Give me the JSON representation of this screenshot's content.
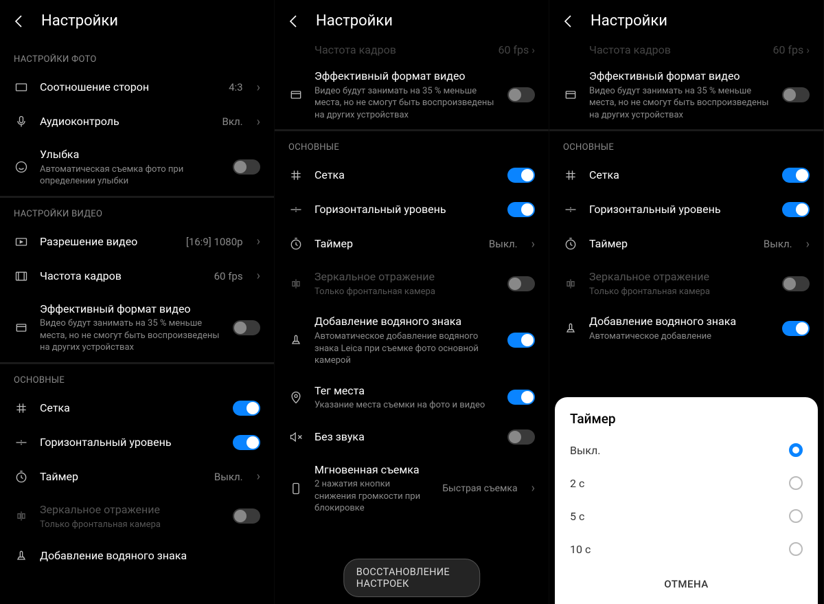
{
  "header": {
    "title": "Настройки"
  },
  "sections": {
    "photo": "НАСТРОЙКИ ФОТО",
    "video": "НАСТРОЙКИ ВИДЕО",
    "main": "ОСНОВНЫЕ"
  },
  "s1": {
    "aspect": {
      "label": "Соотношение сторон",
      "value": "4:3"
    },
    "audio": {
      "label": "Аудиоконтроль",
      "value": "Вкл."
    },
    "smile": {
      "label": "Улыбка",
      "sub": "Автоматическая съемка фото при определении улыбки"
    },
    "resolution": {
      "label": "Разрешение видео",
      "value": "[16:9] 1080p"
    },
    "fps": {
      "label": "Частота кадров",
      "value": "60 fps"
    },
    "efficient": {
      "label": "Эффективный формат видео",
      "sub": "Видео будут занимать на 35 % меньше места, но не смогут быть воспроизведены на других устройствах"
    },
    "grid": {
      "label": "Сетка"
    },
    "level": {
      "label": "Горизонтальный уровень"
    },
    "timer": {
      "label": "Таймер",
      "value": "Выкл."
    },
    "mirror": {
      "label": "Зеркальное отражение",
      "sub": "Только фронтальная камера"
    },
    "watermark": {
      "label": "Добавление водяного знака"
    }
  },
  "s2": {
    "fps_clip": {
      "label": "Частота кадров",
      "value": "60 fps"
    },
    "efficient": {
      "label": "Эффективный формат видео",
      "sub": "Видео будут занимать на 35 % меньше места, но не смогут быть воспроизведены на других устройствах"
    },
    "grid": {
      "label": "Сетка"
    },
    "level": {
      "label": "Горизонтальный уровень"
    },
    "timer": {
      "label": "Таймер",
      "value": "Выкл."
    },
    "mirror": {
      "label": "Зеркальное отражение",
      "sub": "Только фронтальная камера"
    },
    "watermark": {
      "label": "Добавление водяного знака",
      "sub": "Автоматическое добавление водяного знака Leica при съемке фото основной камерой"
    },
    "geotag": {
      "label": "Тег места",
      "sub": "Указание места съемки на фото и видео"
    },
    "mute": {
      "label": "Без звука"
    },
    "instant": {
      "label": "Мгновенная съемка",
      "sub": "2 нажатия кнопки снижения громкости при блокировке",
      "value": "Быстрая съемка"
    },
    "restore": "ВОССТАНОВЛЕНИЕ НАСТРОЕК"
  },
  "s3": {
    "fps_clip": {
      "label": "Частота кадров",
      "value": "60 fps"
    },
    "efficient": {
      "label": "Эффективный формат видео",
      "sub": "Видео будут занимать на 35 % меньше места, но не смогут быть воспроизведены на других устройствах"
    },
    "grid": {
      "label": "Сетка"
    },
    "level": {
      "label": "Горизонтальный уровень"
    },
    "timer": {
      "label": "Таймер",
      "value": "Выкл."
    },
    "mirror": {
      "label": "Зеркальное отражение",
      "sub": "Только фронтальная камера"
    },
    "watermark": {
      "label": "Добавление водяного знака",
      "sub": "Автоматическое добавление"
    }
  },
  "modal": {
    "title": "Таймер",
    "options": [
      "Выкл.",
      "2 с",
      "5 с",
      "10 с"
    ],
    "cancel": "ОТМЕНА"
  }
}
